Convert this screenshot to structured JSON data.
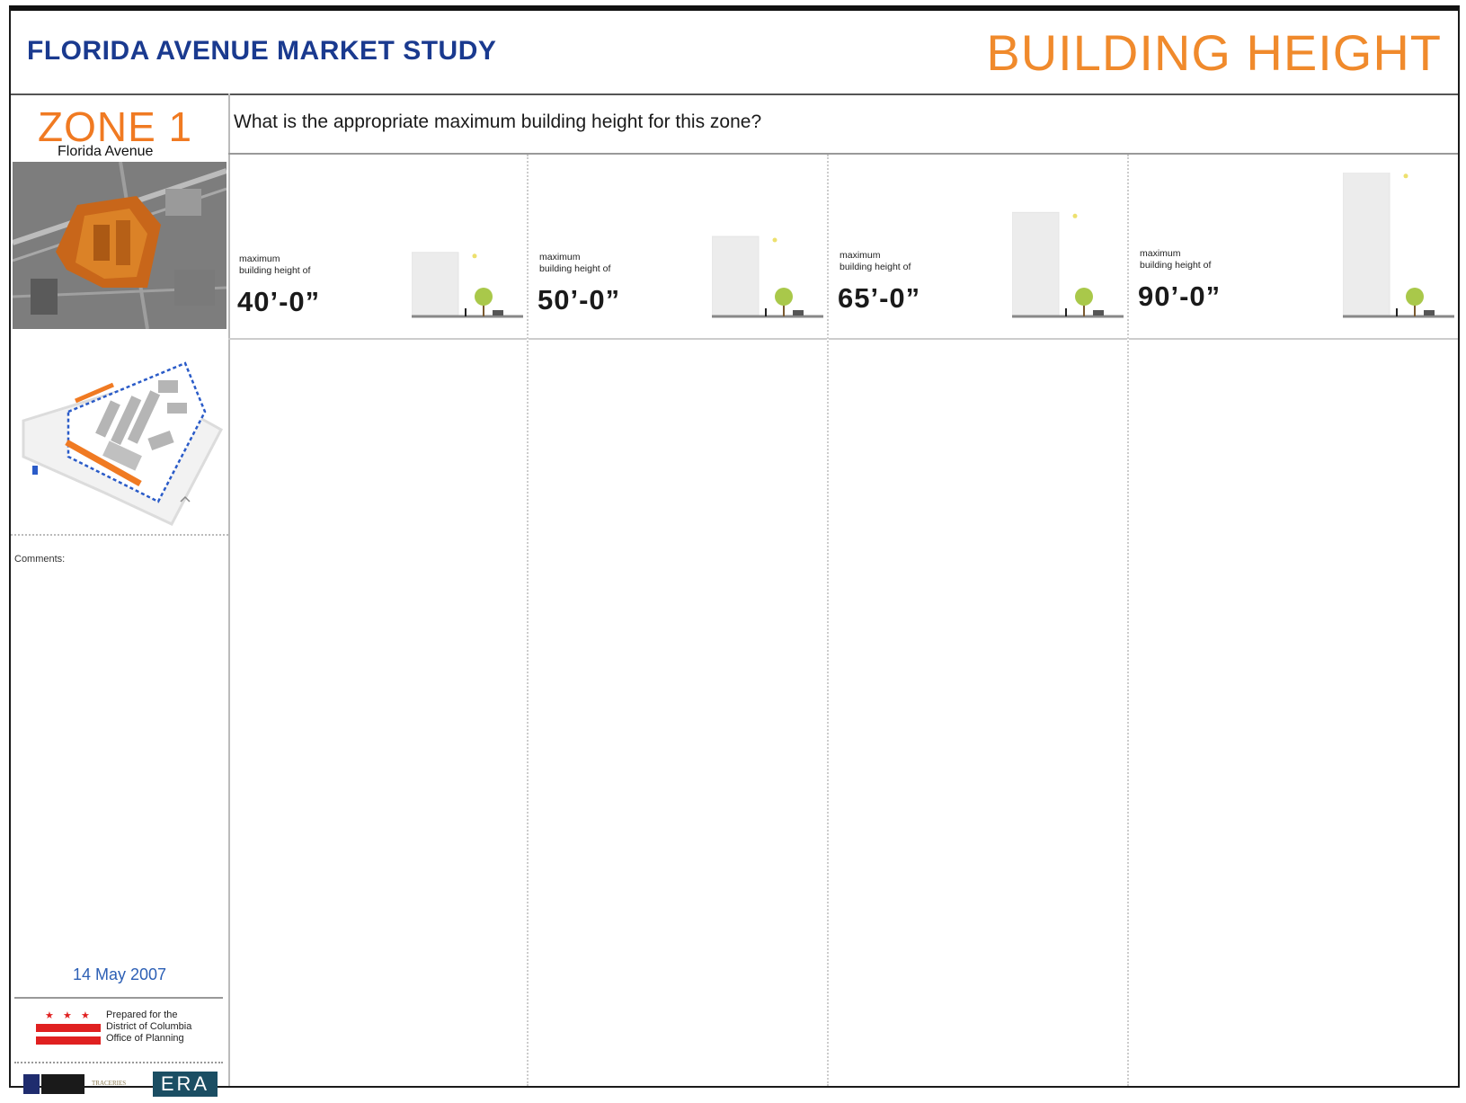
{
  "header": {
    "project_title": "FLORIDA AVENUE MARKET STUDY",
    "page_title": "BUILDING HEIGHT"
  },
  "sidebar": {
    "zone_title": "ZONE 1",
    "zone_subtitle": "Florida Avenue",
    "comments_label": "Comments:",
    "date": "14 May 2007",
    "prepared_for": {
      "line1": "Prepared for the",
      "line2": "District of Columbia",
      "line3": "Office of Planning"
    },
    "logos": {
      "era": "ERA",
      "traceries": "TRACERIES"
    }
  },
  "main": {
    "question": "What is the appropriate maximum building height for this zone?",
    "options": [
      {
        "label_line1": "maximum",
        "label_line2": "building height of",
        "height": "40’-0”",
        "height_ft": 40
      },
      {
        "label_line1": "maximum",
        "label_line2": "building height of",
        "height": "50’-0”",
        "height_ft": 50
      },
      {
        "label_line1": "maximum",
        "label_line2": "building height of",
        "height": "65’-0”",
        "height_ft": 65
      },
      {
        "label_line1": "maximum",
        "label_line2": "building height of",
        "height": "90’-0”",
        "height_ft": 90
      }
    ]
  },
  "colors": {
    "accent_orange": "#f08a2c",
    "title_blue": "#1a3a8f",
    "date_blue": "#2c5fb5",
    "dc_flag_red": "#e02020"
  }
}
